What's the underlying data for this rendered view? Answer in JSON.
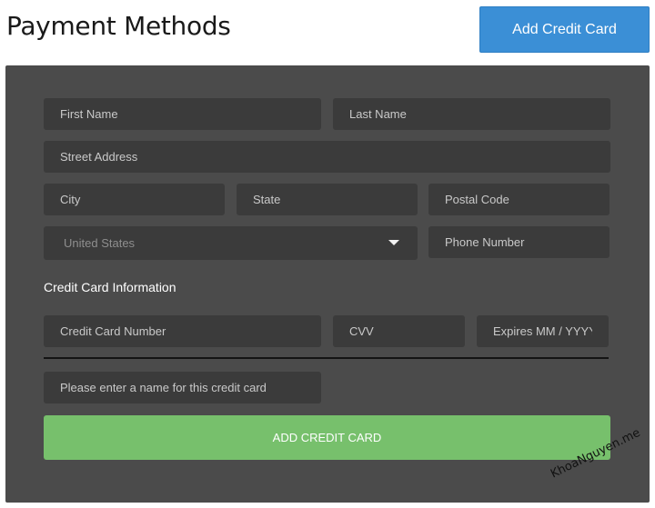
{
  "header": {
    "title": "Payment Methods",
    "add_button_label": "Add Credit Card"
  },
  "form": {
    "first_name": {
      "placeholder": "First Name",
      "value": ""
    },
    "last_name": {
      "placeholder": "Last Name",
      "value": ""
    },
    "street_address": {
      "placeholder": "Street Address",
      "value": ""
    },
    "city": {
      "placeholder": "City",
      "value": ""
    },
    "state": {
      "placeholder": "State",
      "value": ""
    },
    "postal_code": {
      "placeholder": "Postal Code",
      "value": ""
    },
    "country": {
      "selected": "United States"
    },
    "phone": {
      "placeholder": "Phone Number",
      "value": ""
    },
    "credit_card_section_label": "Credit Card Information",
    "card_number": {
      "placeholder": "Credit Card Number",
      "value": ""
    },
    "cvv": {
      "placeholder": "CVV",
      "value": ""
    },
    "expires": {
      "placeholder": "Expires MM / YYYY",
      "value": ""
    },
    "card_name": {
      "placeholder": "Please enter a name for this credit card",
      "value": ""
    },
    "submit_label": "ADD CREDIT CARD"
  },
  "watermark": "KhoaNguyen.me",
  "icons": {
    "country_dropdown": "caret-down-icon"
  },
  "colors": {
    "panel_bg": "#4b4b4b",
    "field_bg": "#3b3b3b",
    "primary_button": "#3b8fd6",
    "submit_button": "#77c06c"
  }
}
